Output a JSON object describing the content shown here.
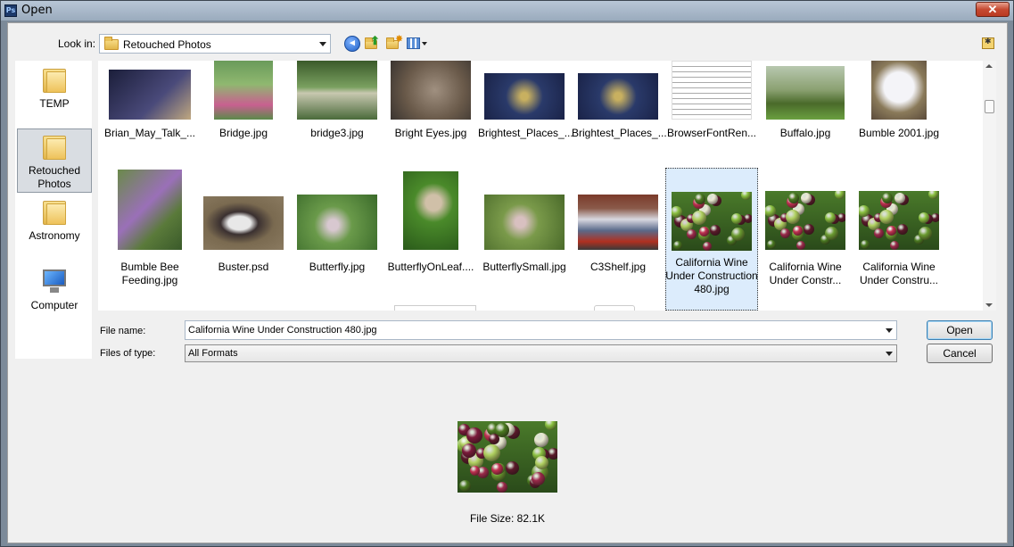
{
  "window": {
    "title": "Open",
    "app_icon_text": "Ps"
  },
  "toolbar": {
    "look_in_label": "Look in:",
    "look_in_value": "Retouched Photos",
    "icons": [
      "back-icon",
      "up-folder-icon",
      "new-folder-icon",
      "view-menu-icon"
    ]
  },
  "places": [
    {
      "label": "TEMP",
      "icon": "folder-icon",
      "selected": false
    },
    {
      "label": "Retouched Photos",
      "icon": "folder-icon",
      "selected": true
    },
    {
      "label": "Astronomy",
      "icon": "folder-icon",
      "selected": false
    },
    {
      "label": "Computer",
      "icon": "computer-icon",
      "selected": false
    }
  ],
  "files": {
    "row1": [
      "Brian_May_Talk_...",
      "Bridge.jpg",
      "bridge3.jpg",
      "Bright Eyes.jpg",
      "Brightest_Places_...",
      "Brightest_Places_...",
      "BrowserFontRen...",
      "Buffalo.jpg",
      "Bumble 2001.jpg"
    ],
    "row2": [
      "Bumble Bee Feeding.jpg",
      "Buster.psd",
      "Butterfly.jpg",
      "ButterflyOnLeaf....",
      "ButterflySmall.jpg",
      "C3Shelf.jpg",
      "California Wine Under Construction 480.jpg",
      "California Wine Under Constr...",
      "California Wine Under Constru..."
    ],
    "selected": "California Wine Under Construction 480.jpg"
  },
  "form": {
    "file_name_label": "File name:",
    "file_name_value": "California Wine Under Construction 480.jpg",
    "file_type_label": "Files of type:",
    "file_type_value": "All Formats",
    "open_label": "Open",
    "cancel_label": "Cancel"
  },
  "preview": {
    "file_size": "File Size: 82.1K"
  },
  "colors": {
    "selection": "#dcecfc",
    "titlebar": "#9aabbd",
    "close": "#c64a32"
  }
}
